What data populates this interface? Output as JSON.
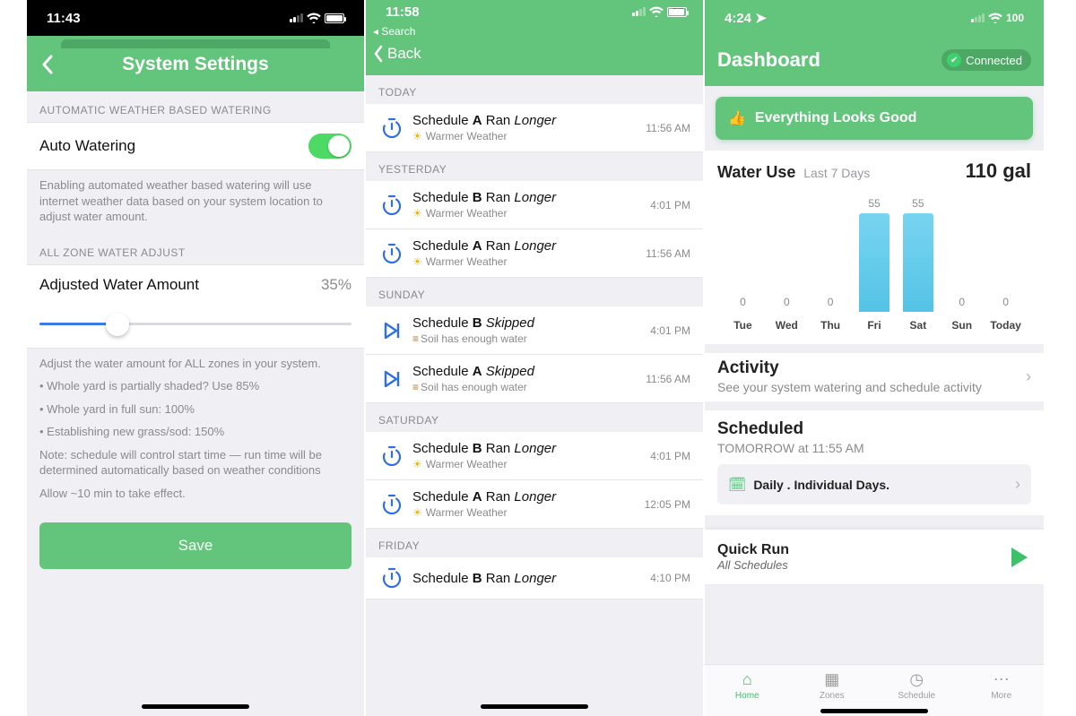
{
  "colors": {
    "accent": "#63c47b",
    "blue": "#3b7be8",
    "barTop": "#78d4f0"
  },
  "screen1": {
    "time": "11:43",
    "title": "System Settings",
    "sec1": "AUTOMATIC WEATHER BASED WATERING",
    "autoLabel": "Auto Watering",
    "autoOn": true,
    "autoHelp": "Enabling automated weather based watering will use internet weather data based on your system location to adjust water amount.",
    "sec2": "ALL ZONE WATER ADJUST",
    "adjLabel": "Adjusted Water Amount",
    "adjValue": "35%",
    "sliderPct": 25,
    "helpLines": [
      "Adjust the water amount for ALL zones in your system.",
      "• Whole yard is partially shaded? Use 85%",
      "• Whole yard in full sun: 100%",
      "• Establishing new grass/sod: 150%",
      "Note: schedule will control start time — run time will be determined automatically based on weather conditions",
      "Allow ~10 min to take effect."
    ],
    "save": "Save"
  },
  "screen2": {
    "time": "11:58",
    "battery": "87",
    "search": "Search",
    "back": "Back",
    "groups": [
      {
        "label": "TODAY",
        "rows": [
          {
            "schedule": "A",
            "status": "Ran",
            "emph": "Longer",
            "reason": "Warmer Weather",
            "icon": "timer",
            "time": "11:56 AM"
          }
        ]
      },
      {
        "label": "YESTERDAY",
        "rows": [
          {
            "schedule": "B",
            "status": "Ran",
            "emph": "Longer",
            "reason": "Warmer Weather",
            "icon": "timer",
            "time": "4:01 PM"
          },
          {
            "schedule": "A",
            "status": "Ran",
            "emph": "Longer",
            "reason": "Warmer Weather",
            "icon": "timer",
            "time": "11:56 AM"
          }
        ]
      },
      {
        "label": "SUNDAY",
        "rows": [
          {
            "schedule": "B",
            "status": "",
            "emph": "Skipped",
            "reason": "Soil has enough water",
            "icon": "skip",
            "time": "4:01 PM"
          },
          {
            "schedule": "A",
            "status": "",
            "emph": "Skipped",
            "reason": "Soil has enough water",
            "icon": "skip",
            "time": "11:56 AM"
          }
        ]
      },
      {
        "label": "SATURDAY",
        "rows": [
          {
            "schedule": "B",
            "status": "Ran",
            "emph": "Longer",
            "reason": "Warmer Weather",
            "icon": "timer",
            "time": "4:01 PM"
          },
          {
            "schedule": "A",
            "status": "Ran",
            "emph": "Longer",
            "reason": "Warmer Weather",
            "icon": "timer",
            "time": "12:05 PM"
          }
        ]
      },
      {
        "label": "FRIDAY",
        "rows": [
          {
            "schedule": "B",
            "status": "Ran",
            "emph": "Longer",
            "reason": "",
            "icon": "timer",
            "time": "4:10 PM"
          }
        ]
      }
    ]
  },
  "screen3": {
    "time": "4:24",
    "wifiPct": "100",
    "title": "Dashboard",
    "connected": "Connected",
    "banner": "Everything Looks Good",
    "waterTitle": "Water Use",
    "waterSub": "Last 7 Days",
    "waterTotal": "110 gal",
    "activityTitle": "Activity",
    "activitySub": "See your system watering and schedule activity",
    "schedTitle": "Scheduled",
    "schedSub": "TOMORROW at 11:55 AM",
    "schedRow": "Daily . Individual Days.",
    "quickTitle": "Quick Run",
    "quickSub": "All Schedules",
    "tabs": [
      "Home",
      "Zones",
      "Schedule",
      "More"
    ]
  },
  "chart_data": {
    "type": "bar",
    "categories": [
      "Tue",
      "Wed",
      "Thu",
      "Fri",
      "Sat",
      "Sun",
      "Today"
    ],
    "values": [
      0,
      0,
      0,
      55,
      55,
      0,
      0
    ],
    "title": "Water Use — Last 7 Days",
    "ylabel": "gal",
    "ylim": [
      0,
      60
    ]
  }
}
